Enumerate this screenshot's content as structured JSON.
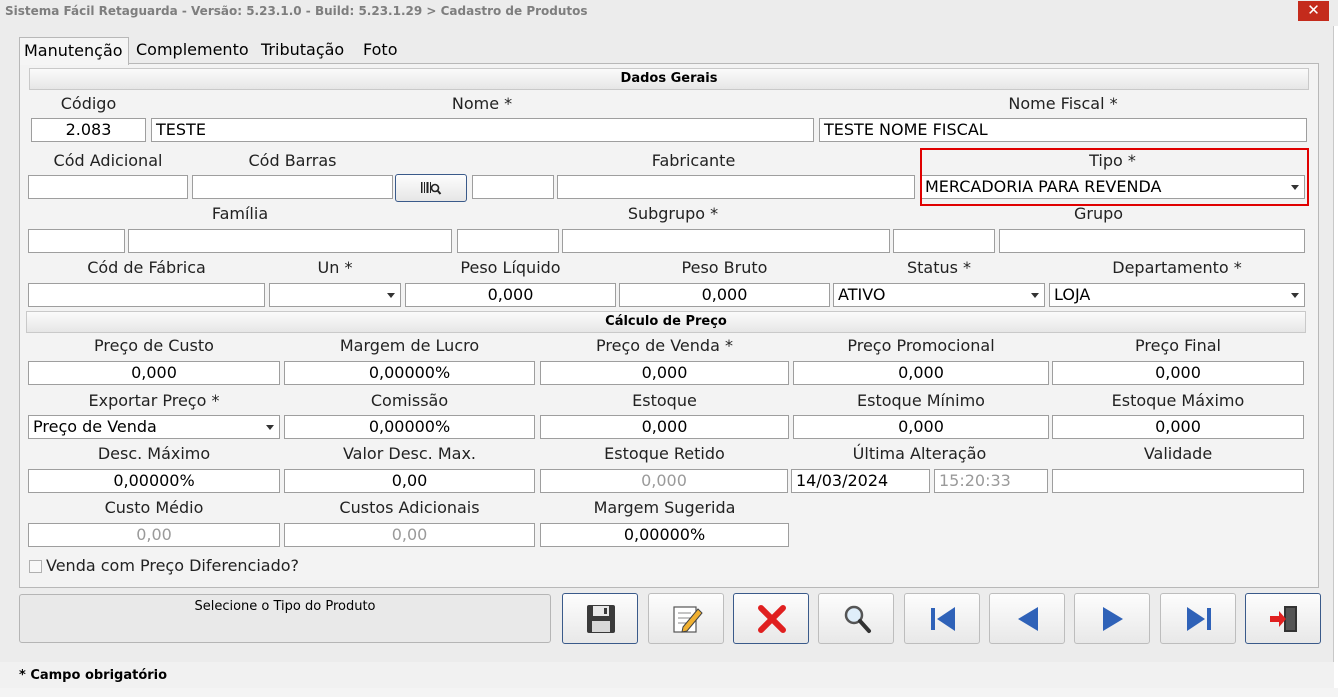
{
  "window": {
    "title": "Sistema Fácil Retaguarda - Versão: 5.23.1.0  - Build: 5.23.1.29 > Cadastro de Produtos",
    "close_glyph": "✕"
  },
  "tabs": [
    "Manutenção",
    "Complemento",
    "Tributação",
    "Foto"
  ],
  "sections": {
    "dados_gerais": "Dados Gerais",
    "calculo_preco": "Cálculo de Preço"
  },
  "labels": {
    "codigo": "Código",
    "nome": "Nome *",
    "nome_fiscal": "Nome Fiscal *",
    "cod_adicional": "Cód Adicional",
    "cod_barras": "Cód Barras",
    "fabricante": "Fabricante",
    "tipo": "Tipo *",
    "familia": "Família",
    "subgrupo": "Subgrupo *",
    "grupo": "Grupo",
    "cod_fabrica": "Cód de Fábrica",
    "un": "Un *",
    "peso_liquido": "Peso Líquido",
    "peso_bruto": "Peso Bruto",
    "status": "Status *",
    "departamento": "Departamento *",
    "preco_custo": "Preço de Custo",
    "margem_lucro": "Margem de Lucro",
    "preco_venda": "Preço de Venda *",
    "preco_promocional": "Preço Promocional",
    "preco_final": "Preço Final",
    "exportar_preco": "Exportar Preço *",
    "comissao": "Comissão",
    "estoque": "Estoque",
    "estoque_minimo": "Estoque Mínimo",
    "estoque_maximo": "Estoque Máximo",
    "desc_maximo": "Desc. Máximo",
    "valor_desc_max": "Valor Desc. Max.",
    "estoque_retido": "Estoque Retido",
    "ultima_alteracao": "Última Alteração",
    "validade": "Validade",
    "custo_medio": "Custo Médio",
    "custos_adicionais": "Custos Adicionais",
    "margem_sugerida": "Margem Sugerida"
  },
  "values": {
    "codigo": "2.083",
    "nome": "TESTE",
    "nome_fiscal": "TESTE NOME FISCAL",
    "cod_adicional": "",
    "cod_barras": "",
    "fabricante_cod": "",
    "fabricante": "",
    "tipo": "MERCADORIA PARA REVENDA",
    "familia_cod": "",
    "familia": "",
    "subgrupo_cod": "",
    "subgrupo": "",
    "grupo_cod": "",
    "grupo": "",
    "cod_fabrica": "",
    "un": "",
    "peso_liquido": "0,000",
    "peso_bruto": "0,000",
    "status": "ATIVO",
    "departamento": "LOJA",
    "preco_custo": "0,000",
    "margem_lucro": "0,00000%",
    "preco_venda": "0,000",
    "preco_promocional": "0,000",
    "preco_final": "0,000",
    "exportar_preco": "Preço de Venda",
    "comissao": "0,00000%",
    "estoque": "0,000",
    "estoque_minimo": "0,000",
    "estoque_maximo": "0,000",
    "desc_maximo": "0,00000%",
    "valor_desc_max": "0,00",
    "estoque_retido": "0,000",
    "ultima_alteracao_data": "14/03/2024",
    "ultima_alteracao_hora": "15:20:33",
    "validade": "",
    "custo_medio": "0,00",
    "custos_adicionais": "0,00",
    "margem_sugerida": "0,00000%"
  },
  "checkbox": {
    "label": "Venda com Preço Diferenciado?",
    "checked": false
  },
  "status_message": "Selecione o Tipo do Produto",
  "footer": "*  Campo obrigatório",
  "toolbar_icons": [
    "save-icon",
    "edit-icon",
    "delete-icon",
    "search-icon",
    "first-record-icon",
    "previous-record-icon",
    "next-record-icon",
    "last-record-icon",
    "exit-icon"
  ],
  "colors": {
    "highlight": "#e00000",
    "nav_blue": "#2f62b8",
    "delete_red": "#e02020"
  }
}
